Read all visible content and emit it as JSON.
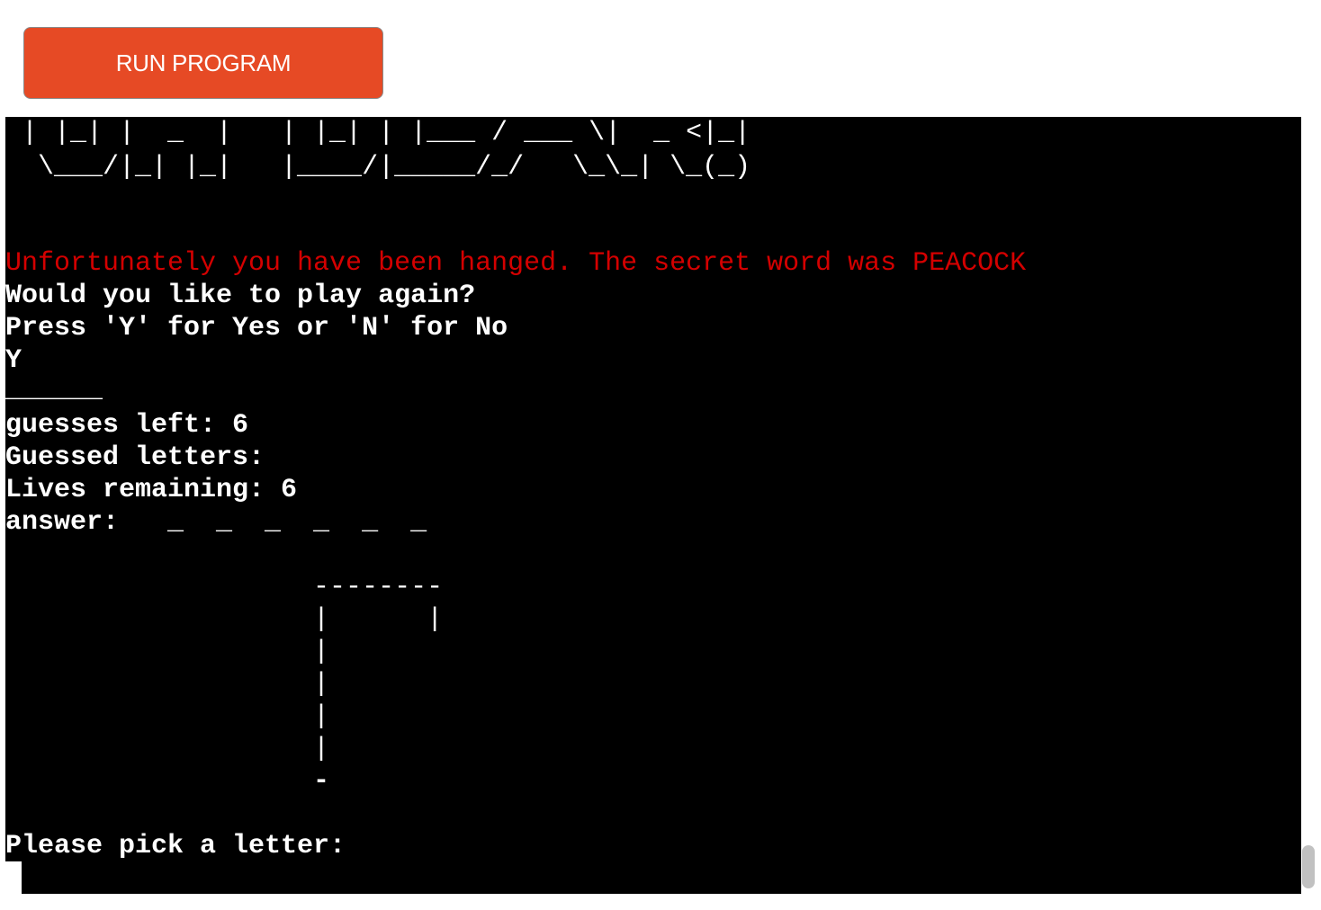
{
  "toolbar": {
    "run_label": "RUN PROGRAM"
  },
  "terminal": {
    "banner": [
      " | |_| |  _  |   | |_| | |___ / ___ \\|  _ <|_|",
      "  \\___/|_| |_|   |____/|_____/_/   \\_\\_| \\_(_)"
    ],
    "lost_message": "Unfortunately you have been hanged. The secret word was PEACOCK",
    "play_again_prompt": "Would you like to play again?",
    "play_again_options": "Press 'Y' for Yes or 'N' for No",
    "user_input": "Y",
    "separator": "______",
    "guesses_left": "guesses left: 6",
    "guessed_letters": "Guessed letters:",
    "lives_remaining": "Lives remaining: 6",
    "answer": "answer:   _  _  _  _  _  _",
    "gallows": [
      "                   --------",
      "                   |      |",
      "                   |",
      "                   |",
      "                   |",
      "                   |",
      "                   -"
    ],
    "pick_prompt": "Please pick a letter:"
  },
  "colors": {
    "button_bg": "#e64a25",
    "terminal_bg": "#000000",
    "terminal_text": "#ffffff",
    "error_text": "#d40000"
  }
}
